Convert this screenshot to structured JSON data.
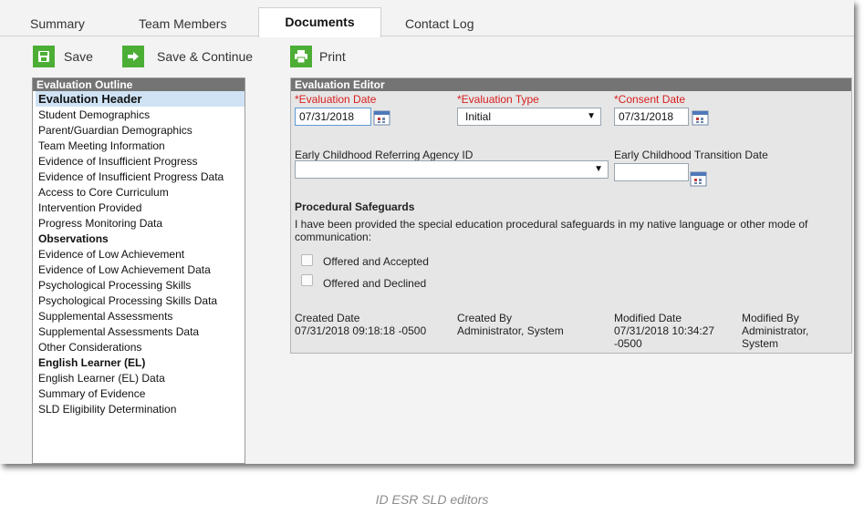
{
  "tabs": [
    {
      "label": "Summary"
    },
    {
      "label": "Team Members"
    },
    {
      "label": "Documents"
    },
    {
      "label": "Contact Log"
    }
  ],
  "active_tab": "Documents",
  "toolbar": {
    "save": "Save",
    "save_continue": "Save & Continue",
    "print": "Print"
  },
  "outline": {
    "title": "Evaluation Outline",
    "items": [
      {
        "label": "Evaluation Header",
        "bold": true,
        "selected": true
      },
      {
        "label": "Student Demographics"
      },
      {
        "label": "Parent/Guardian Demographics"
      },
      {
        "label": "Team Meeting Information"
      },
      {
        "label": "Evidence of Insufficient Progress"
      },
      {
        "label": "Evidence of Insufficient Progress Data"
      },
      {
        "label": "Access to Core Curriculum"
      },
      {
        "label": "Intervention Provided"
      },
      {
        "label": "Progress Monitoring Data"
      },
      {
        "label": "Observations",
        "bold": true
      },
      {
        "label": "Evidence of Low Achievement"
      },
      {
        "label": "Evidence of Low Achievement Data"
      },
      {
        "label": "Psychological Processing Skills"
      },
      {
        "label": "Psychological Processing Skills Data"
      },
      {
        "label": "Supplemental Assessments"
      },
      {
        "label": "Supplemental Assessments Data"
      },
      {
        "label": "Other Considerations"
      },
      {
        "label": "English Learner (EL)",
        "bold": true
      },
      {
        "label": "English Learner (EL) Data"
      },
      {
        "label": "Summary of Evidence"
      },
      {
        "label": "SLD Eligibility Determination"
      }
    ]
  },
  "editor": {
    "title": "Evaluation Editor",
    "required_mark": "*",
    "evaluation_date_label": "Evaluation Date",
    "evaluation_date_value": "07/31/2018",
    "evaluation_type_label": "Evaluation Type",
    "evaluation_type_value": "Initial",
    "consent_date_label": "Consent Date",
    "consent_date_value": "07/31/2018",
    "referring_agency_label": "Early Childhood Referring Agency ID",
    "referring_agency_value": "",
    "transition_date_label": "Early Childhood Transition Date",
    "transition_date_value": "",
    "safeguards_heading": "Procedural Safeguards",
    "safeguards_text": "I have been provided the special education procedural safeguards in my native language or other mode of communication:",
    "offered_accepted": "Offered and Accepted",
    "offered_declined": "Offered and Declined",
    "created_date_label": "Created Date",
    "created_date_value": "07/31/2018 09:18:18 -0500",
    "created_by_label": "Created By",
    "created_by_value": "Administrator, System",
    "modified_date_label": "Modified Date",
    "modified_date_value": "07/31/2018 10:34:27 -0500",
    "modified_by_label": "Modified By",
    "modified_by_value": "Administrator, System"
  },
  "caption": "ID ESR SLD editors",
  "colors": {
    "accent_green": "#4cae35",
    "required_red": "#d81e1e",
    "panel_header": "#747474",
    "selected_row": "#cfe3f5"
  }
}
